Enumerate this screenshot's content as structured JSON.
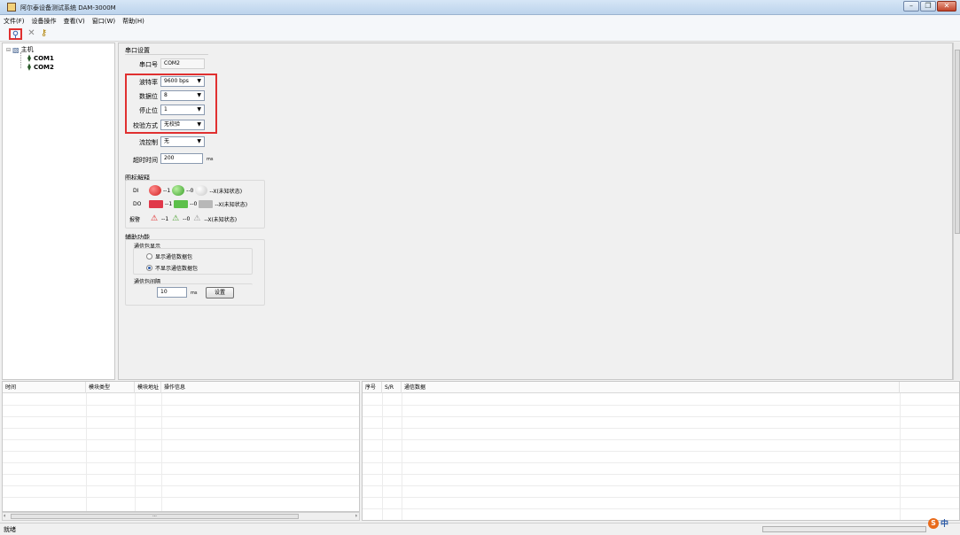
{
  "window": {
    "title": "阿尔泰设备测试系统 DAM-3000M"
  },
  "menu": [
    "文件(F)",
    "设备操作",
    "查看(V)",
    "窗口(W)",
    "帮助(H)"
  ],
  "toolbar": {
    "search_icon": "search-icon",
    "delete_icon": "close-icon",
    "key_icon": "key-icon"
  },
  "tree": {
    "root": "主机",
    "nodes": [
      "COM1",
      "COM2"
    ]
  },
  "serial": {
    "section": "串口设置",
    "port_label": "串口号",
    "port_value": "COM2",
    "baud_label": "波特率",
    "baud_value": "9600 bps",
    "data_bits_label": "数据位",
    "data_bits_value": "8",
    "stop_bits_label": "停止位",
    "stop_bits_value": "1",
    "parity_label": "校验方式",
    "parity_value": "无校验",
    "flow_label": "流控制",
    "flow_value": "无",
    "timeout_label": "超时时间",
    "timeout_value": "200",
    "timeout_unit": "ms"
  },
  "legend": {
    "section": "图标解释",
    "di_label": "DI",
    "do_label": "DO",
    "alarm_label": "报警",
    "one": "--1",
    "zero": "--0",
    "unknown": "--X(未知状态)"
  },
  "aux": {
    "section": "辅助功能",
    "packet_display": "通信包显示",
    "show_option": "显示通信数据包",
    "hide_option": "不显示通信数据包",
    "selected": "hide",
    "interval_label": "通信包间隔",
    "interval_value": "10",
    "interval_unit": "ms",
    "set_button": "设置"
  },
  "log_table": {
    "columns": [
      "时间",
      "模块类型",
      "模块地址",
      "操作信息"
    ]
  },
  "comm_table": {
    "columns": [
      "序号",
      "S/R",
      "通信数据"
    ]
  },
  "status": {
    "text": "就绪"
  },
  "ime": {
    "mode": "中"
  },
  "colors": {
    "highlight": "#e03030",
    "accent": "#2a5aa8"
  }
}
